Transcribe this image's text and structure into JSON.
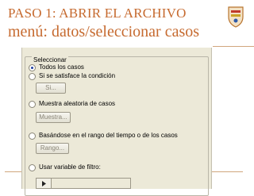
{
  "slide": {
    "title_line1": "PASO 1: ABRIR EL ARCHIVO",
    "title_line2": "menú: datos/seleccionar casos"
  },
  "colors": {
    "title": "#c66a2f",
    "dialog_background": "#ece9d8",
    "selected_radio": "#1f3f9e"
  },
  "dialog": {
    "group_label": "Seleccionar",
    "options": [
      {
        "label": "Todos los casos",
        "selected": true
      },
      {
        "label": "Si se satisface la condición",
        "selected": false
      },
      {
        "label": "Muestra aleatoria de casos",
        "selected": false
      },
      {
        "label": "Basándose en el rango del tiempo o de los casos",
        "selected": false
      },
      {
        "label": "Usar variable de filtro:",
        "selected": false
      }
    ],
    "buttons": {
      "condition": "Si...",
      "sample": "Muestra...",
      "range": "Rango..."
    },
    "filter_variable_value": ""
  },
  "icons": {
    "logo": "university-crest-icon",
    "move_arrow": "arrow-right-icon"
  }
}
